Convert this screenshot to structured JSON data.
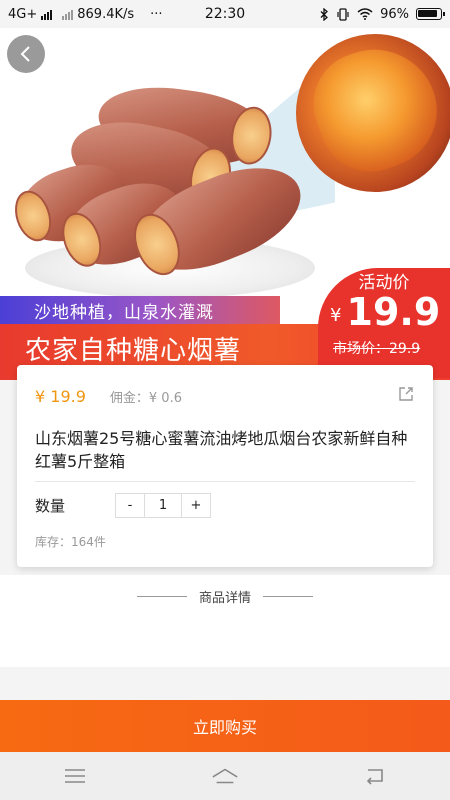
{
  "status_bar": {
    "network": "4G+",
    "speed": "869.4K/s",
    "dots": "···",
    "time": "22:30",
    "battery": "96%"
  },
  "hero": {
    "back_icon": "back-arrow-icon"
  },
  "promo": {
    "subtitle": "沙地种植，山泉水灌溉",
    "title": "农家自种糖心烟薯",
    "badge_label": "活动价",
    "badge_currency": "¥",
    "badge_price": "19.9",
    "market_price": "市场价：29.9"
  },
  "product": {
    "price": "¥ 19.9",
    "commission": "佣金：¥ 0.6",
    "share_icon": "share-icon",
    "title": "山东烟薯25号糖心蜜薯流油烤地瓜烟台农家新鲜自种红薯5斤整箱",
    "qty_label": "数量",
    "minus": "-",
    "quantity": "1",
    "plus": "+",
    "stock": "库存：164件"
  },
  "details": {
    "header": "商品详情"
  },
  "buy_button": {
    "label": "立即购买"
  },
  "colors": {
    "accent_orange": "#f76a12",
    "promo_red": "#e8322c",
    "price_orange": "#f09613"
  }
}
